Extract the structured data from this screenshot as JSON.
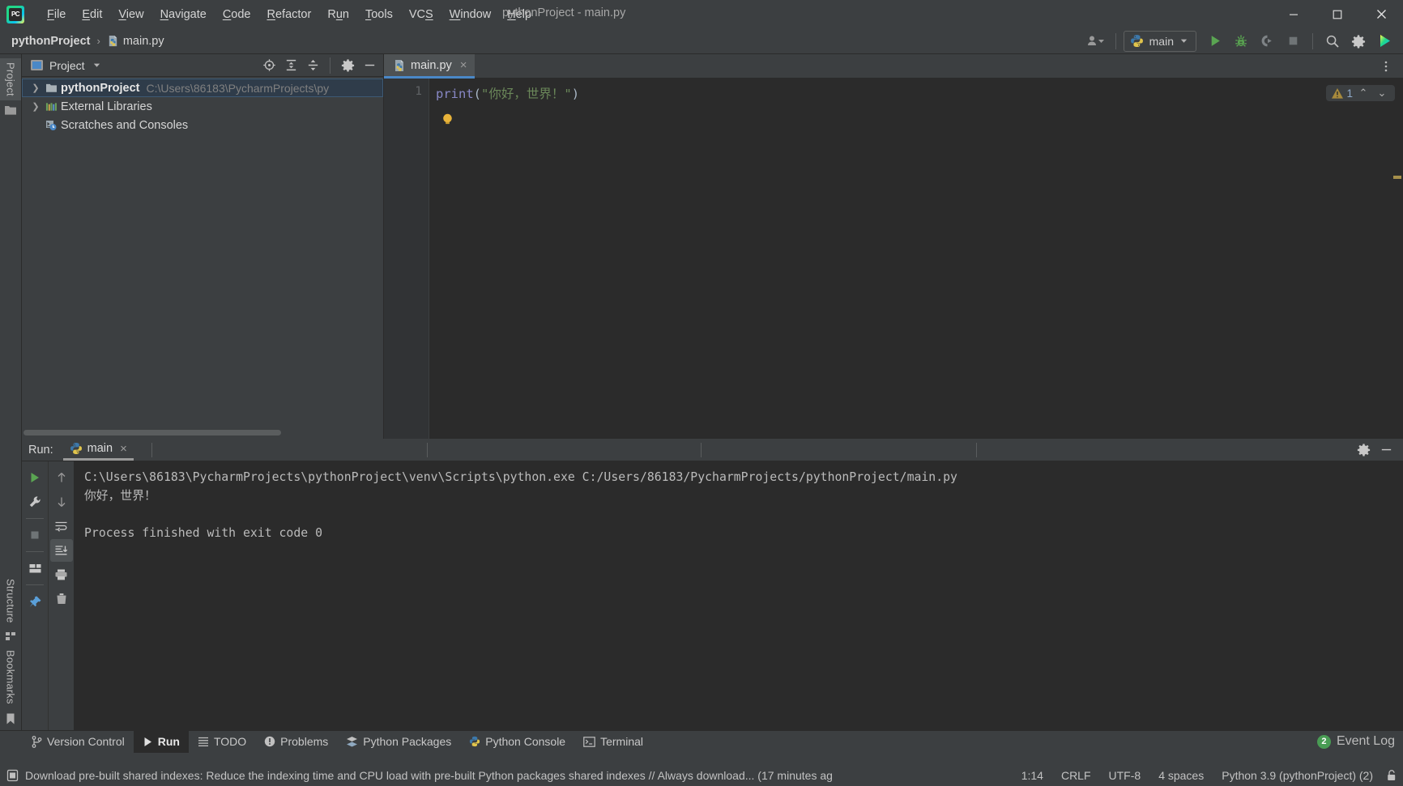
{
  "window": {
    "title": "pythonProject - main.py",
    "logo_text": "PC",
    "controls": {
      "minimize": "minimize-icon",
      "maximize": "maximize-icon",
      "close": "close-icon"
    }
  },
  "menubar": {
    "items": [
      {
        "label": "File",
        "mnemonic": "F"
      },
      {
        "label": "Edit",
        "mnemonic": "E"
      },
      {
        "label": "View",
        "mnemonic": "V"
      },
      {
        "label": "Navigate",
        "mnemonic": "N"
      },
      {
        "label": "Code",
        "mnemonic": "C"
      },
      {
        "label": "Refactor",
        "mnemonic": "R"
      },
      {
        "label": "Run",
        "mnemonic": "u"
      },
      {
        "label": "Tools",
        "mnemonic": "T"
      },
      {
        "label": "VCS",
        "mnemonic": "S"
      },
      {
        "label": "Window",
        "mnemonic": "W"
      },
      {
        "label": "Help",
        "mnemonic": "H"
      }
    ]
  },
  "navbar": {
    "breadcrumb": [
      {
        "label": "pythonProject",
        "icon": "",
        "bold": true
      },
      {
        "label": "main.py",
        "icon": "python-file-icon",
        "bold": false
      }
    ],
    "separator": "›",
    "run_config": {
      "label": "main",
      "icon": "python-icon",
      "dropdown": "chevron-down-icon"
    },
    "profile_icon": "user-profile-icon",
    "buttons": [
      {
        "name": "run-button",
        "icon": "run-icon"
      },
      {
        "name": "debug-button",
        "icon": "debug-icon"
      },
      {
        "name": "coverage-button",
        "icon": "coverage-icon"
      },
      {
        "name": "stop-button",
        "icon": "stop-icon"
      },
      {
        "name": "search-everywhere-button",
        "icon": "search-icon"
      },
      {
        "name": "settings-button",
        "icon": "gear-icon"
      },
      {
        "name": "updates-button",
        "icon": "colorful-play-icon"
      }
    ]
  },
  "stripe": {
    "top": [
      {
        "label": "Project",
        "icon": "folder-icon",
        "active": true
      }
    ],
    "bottom": [
      {
        "label": "Structure",
        "icon": "structure-icon"
      },
      {
        "label": "Bookmarks",
        "icon": "bookmark-icon"
      }
    ]
  },
  "project_panel": {
    "title": "Project",
    "title_icon": "project-view-icon",
    "dropdown": "chevron-down-icon",
    "header_buttons": [
      {
        "name": "select-opened-file-button",
        "icon": "crosshair-icon"
      },
      {
        "name": "expand-all-button",
        "icon": "expand-all-icon"
      },
      {
        "name": "collapse-all-button",
        "icon": "collapse-all-icon"
      },
      {
        "name": "panel-options-button",
        "icon": "gear-icon"
      },
      {
        "name": "hide-panel-button",
        "icon": "minimize-icon"
      }
    ],
    "tree": [
      {
        "label": "pythonProject",
        "sub": "C:\\Users\\86183\\PycharmProjects\\py",
        "icon": "folder-icon",
        "arrow": "chevron-right-icon",
        "bold": true,
        "selected": true,
        "indent": 0
      },
      {
        "label": "External Libraries",
        "sub": "",
        "icon": "libraries-icon",
        "arrow": "chevron-right-icon",
        "bold": false,
        "selected": false,
        "indent": 0
      },
      {
        "label": "Scratches and Consoles",
        "sub": "",
        "icon": "scratches-icon",
        "arrow": "",
        "bold": false,
        "selected": false,
        "indent": 0
      }
    ]
  },
  "editor": {
    "tabs": [
      {
        "label": "main.py",
        "icon": "python-file-icon",
        "close": "×",
        "active": true
      }
    ],
    "line_numbers": [
      "1"
    ],
    "code": {
      "func": "print",
      "open_paren": "(",
      "string": "\"你好，世界！\"",
      "close_paren": ")"
    },
    "intention_bulb": "lightbulb-icon",
    "inspections": {
      "warning_icon": "warning-triangle-icon",
      "count": "1",
      "prev": "⌃",
      "next": "⌄"
    }
  },
  "run_panel": {
    "label": "Run:",
    "tab": {
      "label": "main",
      "icon": "python-icon",
      "close": "×"
    },
    "header_buttons": [
      {
        "name": "run-settings-button",
        "icon": "gear-icon"
      },
      {
        "name": "hide-run-panel-button",
        "icon": "minimize-icon"
      }
    ],
    "left_tools": [
      {
        "name": "rerun-button",
        "icon": "run-icon"
      },
      {
        "name": "modify-run-config-button",
        "icon": "wrench-icon"
      },
      {
        "name": "stop-process-button",
        "icon": "stop-icon"
      },
      {
        "name": "restore-layout-button",
        "icon": "layout-icon"
      },
      {
        "name": "pin-tab-button",
        "icon": "pin-icon"
      }
    ],
    "right_tools": [
      {
        "name": "up-stacktrace-button",
        "icon": "arrow-up-icon"
      },
      {
        "name": "down-stacktrace-button",
        "icon": "arrow-down-icon"
      },
      {
        "name": "soft-wrap-button",
        "icon": "wrap-text-icon"
      },
      {
        "name": "scroll-to-end-button",
        "icon": "scroll-end-icon"
      },
      {
        "name": "print-button",
        "icon": "printer-icon"
      },
      {
        "name": "clear-all-button",
        "icon": "trash-icon"
      }
    ],
    "console_lines": [
      "C:\\Users\\86183\\PycharmProjects\\pythonProject\\venv\\Scripts\\python.exe C:/Users/86183/PycharmProjects/pythonProject/main.py",
      "你好，世界！",
      "",
      "Process finished with exit code 0"
    ]
  },
  "bottom_tabs": [
    {
      "label": "Version Control",
      "icon": "branch-icon",
      "active": false
    },
    {
      "label": "Run",
      "icon": "run-icon",
      "active": true
    },
    {
      "label": "TODO",
      "icon": "list-icon",
      "active": false
    },
    {
      "label": "Problems",
      "icon": "problems-icon",
      "active": false
    },
    {
      "label": "Python Packages",
      "icon": "packages-icon",
      "active": false
    },
    {
      "label": "Python Console",
      "icon": "python-icon",
      "active": false
    },
    {
      "label": "Terminal",
      "icon": "terminal-icon",
      "active": false
    }
  ],
  "event_log": {
    "badge": "2",
    "label": "Event Log"
  },
  "statusbar": {
    "message_icon": "notification-icon",
    "message": "Download pre-built shared indexes: Reduce the indexing time and CPU load with pre-built Python packages shared indexes // Always download... (17 minutes ag",
    "segments": [
      {
        "name": "caret-position",
        "label": "1:14"
      },
      {
        "name": "line-separator",
        "label": "CRLF"
      },
      {
        "name": "file-encoding",
        "label": "UTF-8"
      },
      {
        "name": "indent-setting",
        "label": "4 spaces"
      },
      {
        "name": "python-interpreter",
        "label": "Python 3.9 (pythonProject) (2)"
      }
    ],
    "lock_icon": "read-only-toggle-icon"
  },
  "colors": {
    "bg": "#3c3f41",
    "editor_bg": "#2b2b2b",
    "accent_blue": "#4a88c7",
    "green": "#499c54",
    "string_green": "#6a8759",
    "keyword_purple": "#8888c6"
  }
}
